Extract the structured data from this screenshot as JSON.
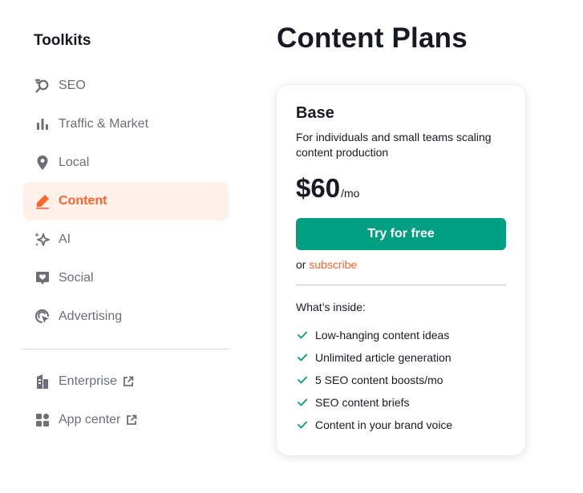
{
  "sidebar": {
    "title": "Toolkits",
    "items": [
      {
        "label": "SEO",
        "icon": "seo-icon"
      },
      {
        "label": "Traffic & Market",
        "icon": "bar-chart-icon"
      },
      {
        "label": "Local",
        "icon": "map-pin-icon"
      },
      {
        "label": "Content",
        "icon": "pen-icon",
        "active": true
      },
      {
        "label": "AI",
        "icon": "sparkles-icon"
      },
      {
        "label": "Social",
        "icon": "heart-chat-icon"
      },
      {
        "label": "Advertising",
        "icon": "cursor-target-icon"
      }
    ],
    "extra_items": [
      {
        "label": "Enterprise",
        "icon": "building-icon",
        "external": true
      },
      {
        "label": "App center",
        "icon": "apps-grid-icon",
        "external": true
      }
    ]
  },
  "main": {
    "title": "Content Plans",
    "plan": {
      "name": "Base",
      "description": "For individuals and small teams scaling content production",
      "price": "$60",
      "period": "/mo",
      "cta_label": "Try for free",
      "or_text": "or",
      "subscribe_label": "subscribe",
      "inside_title": "What’s inside:",
      "features": [
        "Low-hanging content ideas",
        "Unlimited article generation",
        "5 SEO content boosts/mo",
        "SEO content briefs",
        "Content in your brand voice"
      ]
    }
  },
  "colors": {
    "accent_orange": "#ff642d",
    "active_bg": "#fff0e9",
    "cta_green": "#009f81",
    "check_green": "#009f81",
    "muted_text": "#6c6e79"
  }
}
